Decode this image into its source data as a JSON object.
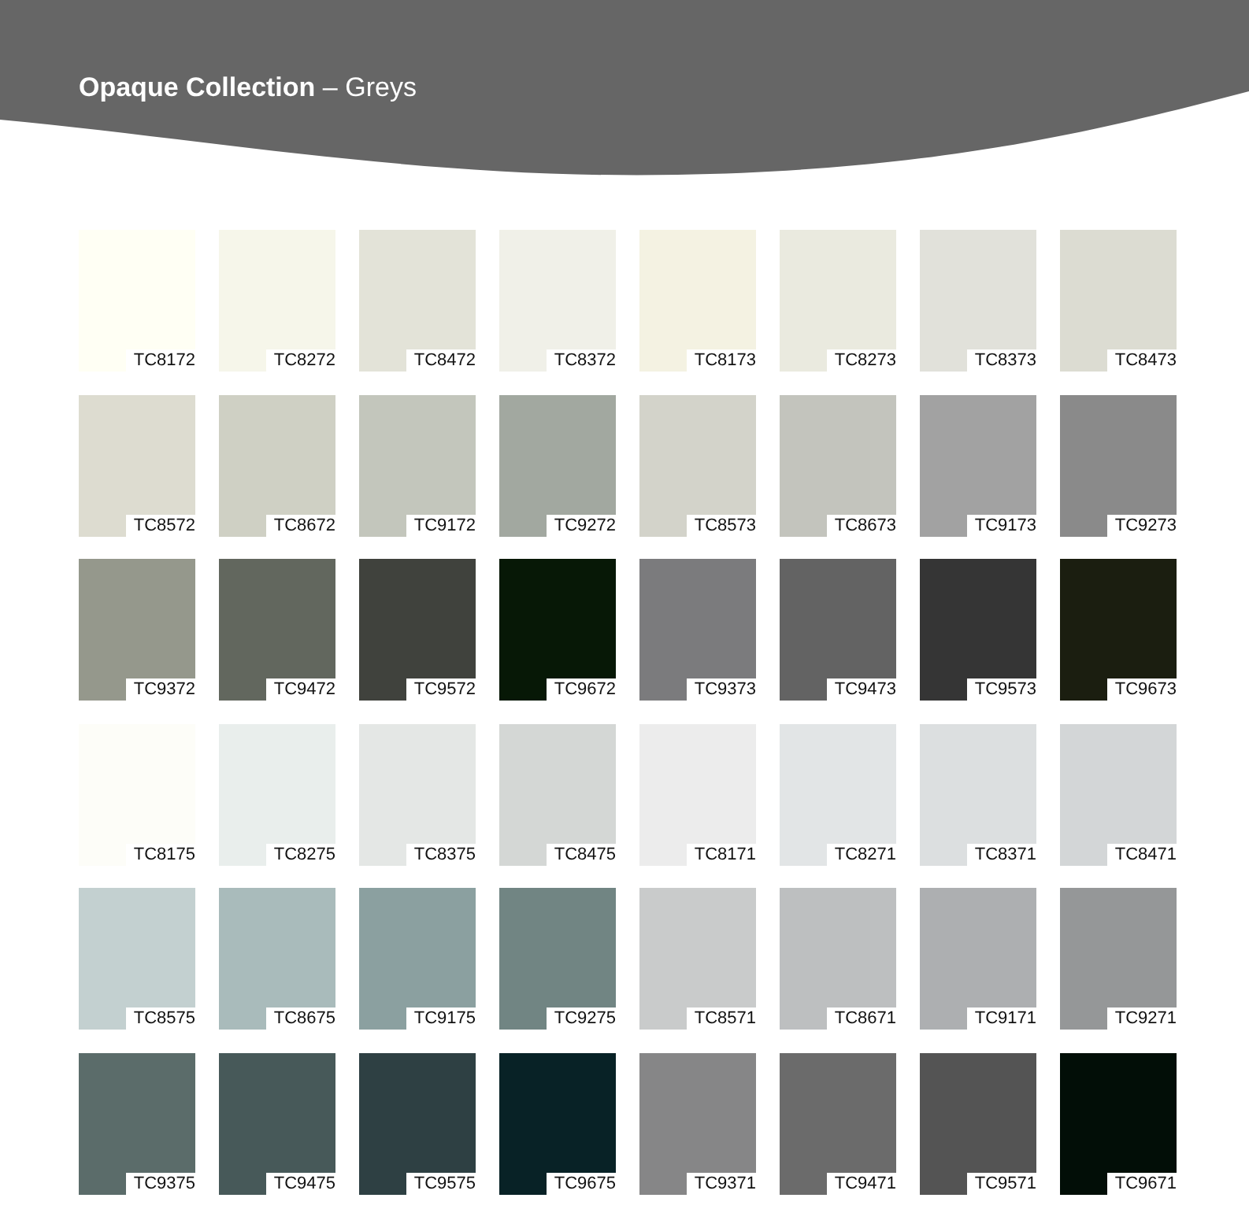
{
  "header": {
    "title_bold": "Opaque Collection",
    "title_rest": "– Greys"
  },
  "swatches": [
    {
      "code": "TC8172",
      "color": "#fffff4"
    },
    {
      "code": "TC8272",
      "color": "#f6f6ea"
    },
    {
      "code": "TC8472",
      "color": "#e3e3d8"
    },
    {
      "code": "TC8372",
      "color": "#f0f0e8"
    },
    {
      "code": "TC8173",
      "color": "#f4f2e2"
    },
    {
      "code": "TC8273",
      "color": "#eaeadf"
    },
    {
      "code": "TC8373",
      "color": "#e1e1da"
    },
    {
      "code": "TC8473",
      "color": "#dcdcd2"
    },
    {
      "code": "TC8572",
      "color": "#dddcd0"
    },
    {
      "code": "TC8672",
      "color": "#cfd0c4"
    },
    {
      "code": "TC9172",
      "color": "#c3c6bc"
    },
    {
      "code": "TC9272",
      "color": "#a2a8a0"
    },
    {
      "code": "TC8573",
      "color": "#d3d3ca"
    },
    {
      "code": "TC8673",
      "color": "#c3c4bd"
    },
    {
      "code": "TC9173",
      "color": "#a2a2a2"
    },
    {
      "code": "TC9273",
      "color": "#8a8a8a"
    },
    {
      "code": "TC9372",
      "color": "#95988c"
    },
    {
      "code": "TC9472",
      "color": "#62675e"
    },
    {
      "code": "TC9572",
      "color": "#40423d"
    },
    {
      "code": "TC9672",
      "color": "#071806"
    },
    {
      "code": "TC9373",
      "color": "#7b7b7d"
    },
    {
      "code": "TC9473",
      "color": "#636363"
    },
    {
      "code": "TC9573",
      "color": "#353535"
    },
    {
      "code": "TC9673",
      "color": "#1b1e10"
    },
    {
      "code": "TC8175",
      "color": "#fdfdf8"
    },
    {
      "code": "TC8275",
      "color": "#e9eeec"
    },
    {
      "code": "TC8375",
      "color": "#e4e7e5"
    },
    {
      "code": "TC8475",
      "color": "#d4d7d5"
    },
    {
      "code": "TC8171",
      "color": "#ececec"
    },
    {
      "code": "TC8271",
      "color": "#e2e5e6"
    },
    {
      "code": "TC8371",
      "color": "#dcdfe0"
    },
    {
      "code": "TC8471",
      "color": "#d3d6d7"
    },
    {
      "code": "TC8575",
      "color": "#c3d0d0"
    },
    {
      "code": "TC8675",
      "color": "#a9bbbb"
    },
    {
      "code": "TC9175",
      "color": "#8ba0a0"
    },
    {
      "code": "TC9275",
      "color": "#718583"
    },
    {
      "code": "TC8571",
      "color": "#c9cbcb"
    },
    {
      "code": "TC8671",
      "color": "#bdbfc0"
    },
    {
      "code": "TC9171",
      "color": "#adafb1"
    },
    {
      "code": "TC9271",
      "color": "#959798"
    },
    {
      "code": "TC9375",
      "color": "#5b6c6a"
    },
    {
      "code": "TC9475",
      "color": "#475959"
    },
    {
      "code": "TC9575",
      "color": "#2e4043"
    },
    {
      "code": "TC9675",
      "color": "#082226"
    },
    {
      "code": "TC9371",
      "color": "#868687"
    },
    {
      "code": "TC9471",
      "color": "#6b6b6b"
    },
    {
      "code": "TC9571",
      "color": "#545454"
    },
    {
      "code": "TC9671",
      "color": "#020e07"
    }
  ]
}
